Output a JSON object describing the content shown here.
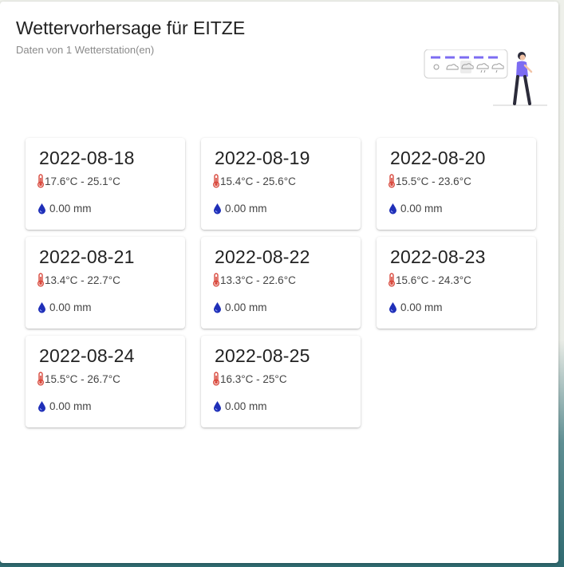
{
  "header": {
    "title": "Wettervorhersage für EITZE",
    "subtitle": "Daten von 1 Wetterstation(en)"
  },
  "colors": {
    "accent": "#7c6cf2",
    "thermometer": "#d94b3f",
    "drop": "#1f2fb8"
  },
  "icons": {
    "temperature": "thermometer-icon",
    "precipitation": "raindrop-icon"
  },
  "forecast": [
    {
      "date": "2022-08-18",
      "temp": "17.6°C - 25.1°C",
      "rain": "0.00 mm"
    },
    {
      "date": "2022-08-19",
      "temp": "15.4°C - 25.6°C",
      "rain": "0.00 mm"
    },
    {
      "date": "2022-08-20",
      "temp": "15.5°C - 23.6°C",
      "rain": "0.00 mm"
    },
    {
      "date": "2022-08-21",
      "temp": "13.4°C - 22.7°C",
      "rain": "0.00 mm"
    },
    {
      "date": "2022-08-22",
      "temp": "13.3°C - 22.6°C",
      "rain": "0.00 mm"
    },
    {
      "date": "2022-08-23",
      "temp": "15.6°C - 24.3°C",
      "rain": "0.00 mm"
    },
    {
      "date": "2022-08-24",
      "temp": "15.5°C - 26.7°C",
      "rain": "0.00 mm"
    },
    {
      "date": "2022-08-25",
      "temp": "16.3°C - 25°C",
      "rain": "0.00 mm"
    }
  ]
}
